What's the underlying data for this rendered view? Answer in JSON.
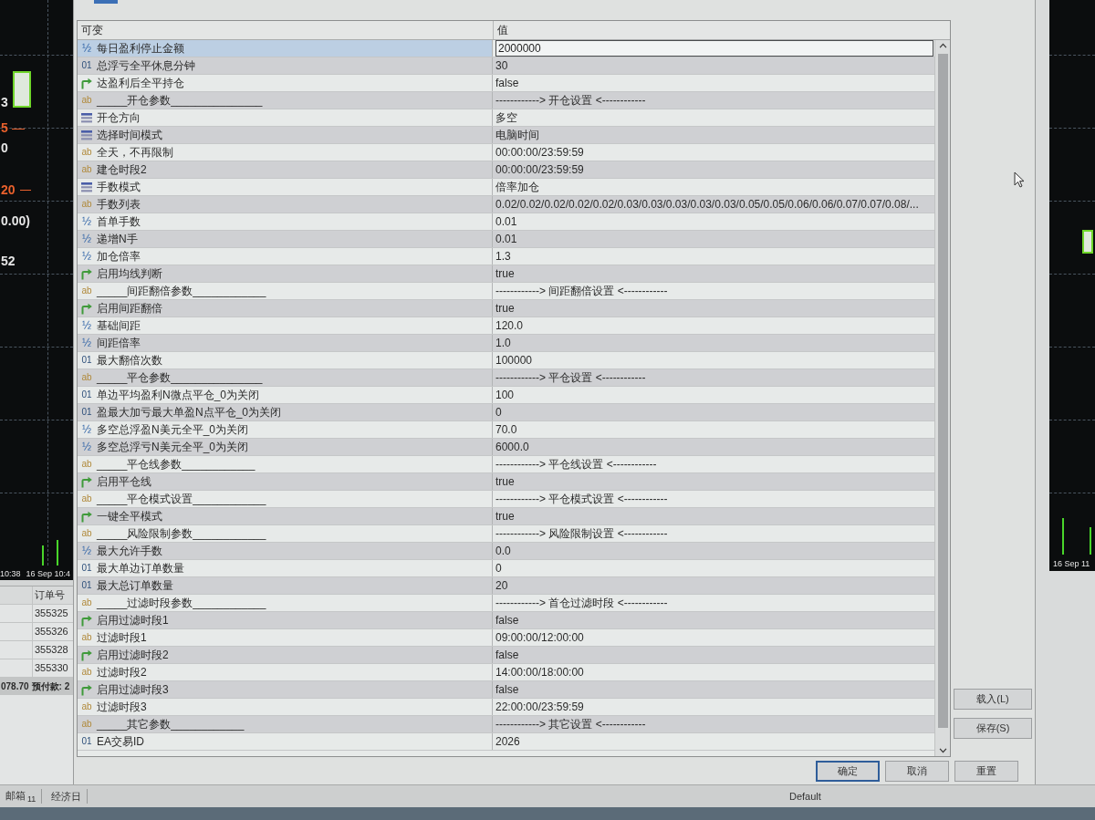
{
  "terminal": {
    "chart_left": {
      "price_labels": [
        {
          "text": "3",
          "color": "#e6e6e6"
        },
        {
          "text": "5",
          "color": "#e8602c"
        },
        {
          "text": "0",
          "color": "#e6e6e6"
        },
        {
          "text": "20",
          "color": "#e8602c"
        },
        {
          "text": "0.00)",
          "color": "#e6e6e6"
        },
        {
          "text": "52",
          "color": "#e6e6e6"
        }
      ],
      "time_labels": [
        "10:38",
        "16 Sep 10:4"
      ]
    },
    "orders": {
      "column": "订单号",
      "rows": [
        "355325",
        "355326",
        "355328",
        "355330"
      ],
      "summary": {
        "balance": "078.70",
        "margin": "预付款: 2"
      }
    },
    "chart_right": {
      "time_label": "16 Sep 11"
    },
    "tabs": [
      {
        "label": "邮箱",
        "count": "11"
      },
      {
        "label": "经济日"
      }
    ],
    "status_bar": {
      "profile": "Default"
    }
  },
  "dialog": {
    "columns": [
      "可变",
      "值"
    ],
    "params": [
      {
        "kind": "double",
        "icon_text": "½",
        "name": "每日盈利停止金额",
        "value": "2000000",
        "selected": true
      },
      {
        "kind": "int",
        "icon_text": "01",
        "name": "总浮亏全平休息分钟",
        "value": "30",
        "selected": false
      },
      {
        "kind": "bool",
        "name": "达盈利后全平持仓",
        "value": "false",
        "selected": false
      },
      {
        "kind": "string",
        "icon_text": "ab",
        "name": "_____开仓参数_______________",
        "value": "------------> 开仓设置 <------------",
        "selected": false
      },
      {
        "kind": "enum",
        "name": "开仓方向",
        "value": "多空",
        "selected": false
      },
      {
        "kind": "enum",
        "name": "选择时间模式",
        "value": "电脑时间",
        "selected": false
      },
      {
        "kind": "string",
        "icon_text": "ab",
        "name": "全天，不再限制",
        "value": "00:00:00/23:59:59",
        "selected": false
      },
      {
        "kind": "string",
        "icon_text": "ab",
        "name": "建仓时段2",
        "value": "00:00:00/23:59:59",
        "selected": false
      },
      {
        "kind": "enum",
        "name": "手数模式",
        "value": "倍率加仓",
        "selected": false
      },
      {
        "kind": "string",
        "icon_text": "ab",
        "name": "手数列表",
        "value": "0.02/0.02/0.02/0.02/0.02/0.03/0.03/0.03/0.03/0.03/0.05/0.05/0.06/0.06/0.07/0.07/0.08/...",
        "selected": false
      },
      {
        "kind": "double",
        "icon_text": "½",
        "name": "首单手数",
        "value": "0.01",
        "selected": false
      },
      {
        "kind": "double",
        "icon_text": "½",
        "name": "递增N手",
        "value": "0.01",
        "selected": false
      },
      {
        "kind": "double",
        "icon_text": "½",
        "name": "加仓倍率",
        "value": "1.3",
        "selected": false
      },
      {
        "kind": "bool",
        "name": "启用均线判断",
        "value": "true",
        "selected": false
      },
      {
        "kind": "string",
        "icon_text": "ab",
        "name": "_____间距翻倍参数____________",
        "value": "------------> 间距翻倍设置 <------------",
        "selected": false
      },
      {
        "kind": "bool",
        "name": "启用间距翻倍",
        "value": "true",
        "selected": false
      },
      {
        "kind": "double",
        "icon_text": "½",
        "name": "基础间距",
        "value": "120.0",
        "selected": false
      },
      {
        "kind": "double",
        "icon_text": "½",
        "name": "间距倍率",
        "value": "1.0",
        "selected": false
      },
      {
        "kind": "int",
        "icon_text": "01",
        "name": "最大翻倍次数",
        "value": "100000",
        "selected": false
      },
      {
        "kind": "string",
        "icon_text": "ab",
        "name": "_____平仓参数_______________",
        "value": "------------> 平仓设置 <------------",
        "selected": false
      },
      {
        "kind": "int",
        "icon_text": "01",
        "name": "单边平均盈利N微点平仓_0为关闭",
        "value": "100",
        "selected": false
      },
      {
        "kind": "int",
        "icon_text": "01",
        "name": "盈最大加亏最大单盈N点平仓_0为关闭",
        "value": "0",
        "selected": false
      },
      {
        "kind": "double",
        "icon_text": "½",
        "name": "多空总浮盈N美元全平_0为关闭",
        "value": "70.0",
        "selected": false
      },
      {
        "kind": "double",
        "icon_text": "½",
        "name": "多空总浮亏N美元全平_0为关闭",
        "value": "6000.0",
        "selected": false
      },
      {
        "kind": "string",
        "icon_text": "ab",
        "name": "_____平仓线参数____________",
        "value": "------------> 平仓线设置 <------------",
        "selected": false
      },
      {
        "kind": "bool",
        "name": "启用平仓线",
        "value": "true",
        "selected": false
      },
      {
        "kind": "string",
        "icon_text": "ab",
        "name": "_____平仓模式设置____________",
        "value": "------------> 平仓模式设置 <------------",
        "selected": false
      },
      {
        "kind": "bool",
        "name": "一键全平模式",
        "value": "true",
        "selected": false
      },
      {
        "kind": "string",
        "icon_text": "ab",
        "name": "_____风险限制参数____________",
        "value": "------------> 风险限制设置 <------------",
        "selected": false
      },
      {
        "kind": "double",
        "icon_text": "½",
        "name": "最大允许手数",
        "value": "0.0",
        "selected": false
      },
      {
        "kind": "int",
        "icon_text": "01",
        "name": "最大单边订单数量",
        "value": "0",
        "selected": false
      },
      {
        "kind": "int",
        "icon_text": "01",
        "name": "最大总订单数量",
        "value": "20",
        "selected": false
      },
      {
        "kind": "string",
        "icon_text": "ab",
        "name": "_____过滤时段参数____________",
        "value": "------------> 首仓过滤时段 <------------",
        "selected": false
      },
      {
        "kind": "bool",
        "name": "启用过滤时段1",
        "value": "false",
        "selected": false
      },
      {
        "kind": "string",
        "icon_text": "ab",
        "name": "过滤时段1",
        "value": "09:00:00/12:00:00",
        "selected": false
      },
      {
        "kind": "bool",
        "name": "启用过滤时段2",
        "value": "false",
        "selected": false
      },
      {
        "kind": "string",
        "icon_text": "ab",
        "name": "过滤时段2",
        "value": "14:00:00/18:00:00",
        "selected": false
      },
      {
        "kind": "bool",
        "name": "启用过滤时段3",
        "value": "false",
        "selected": false
      },
      {
        "kind": "string",
        "icon_text": "ab",
        "name": "过滤时段3",
        "value": "22:00:00/23:59:59",
        "selected": false
      },
      {
        "kind": "string",
        "icon_text": "ab",
        "name": "_____其它参数____________",
        "value": "------------> 其它设置 <------------",
        "selected": false
      },
      {
        "kind": "int",
        "icon_text": "01",
        "name": "EA交易ID",
        "value": "2026",
        "selected": false
      }
    ],
    "side_buttons": [
      "载入(L)",
      "保存(S)"
    ],
    "buttons": [
      {
        "label": "确定",
        "default": true
      },
      {
        "label": "取消",
        "default": false
      },
      {
        "label": "重置",
        "default": false
      }
    ]
  }
}
